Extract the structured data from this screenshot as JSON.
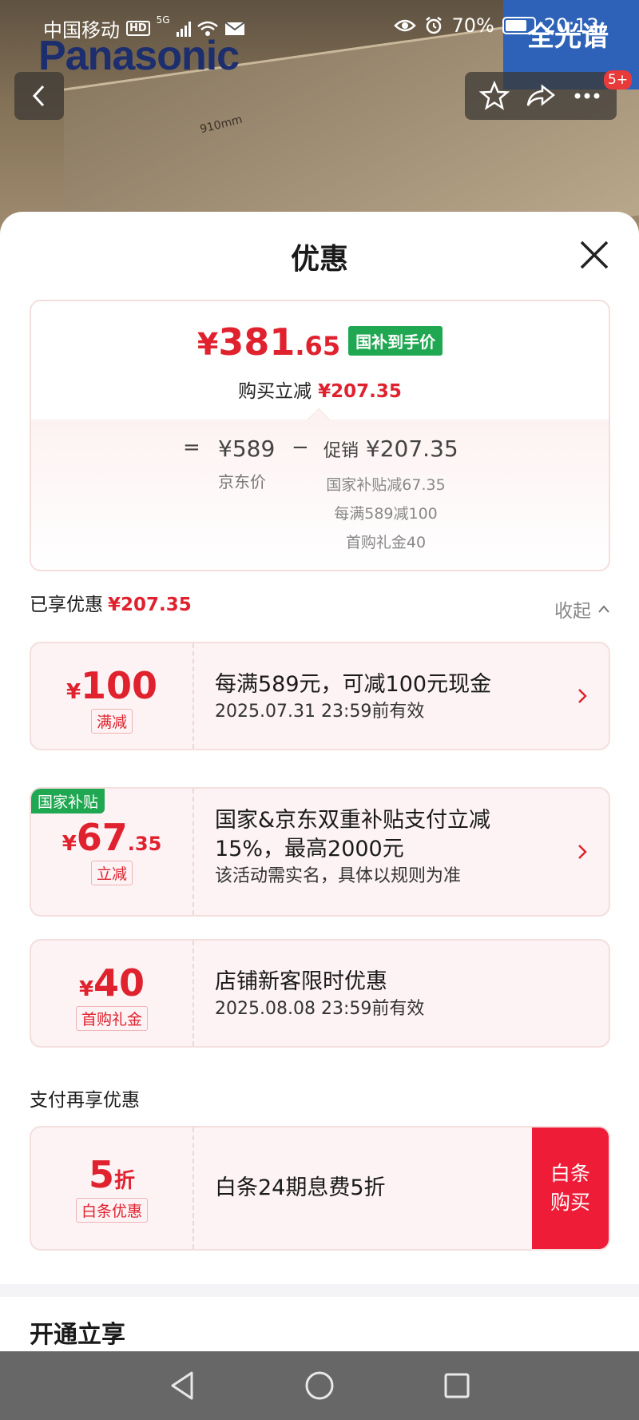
{
  "status_bar": {
    "carrier": "中国移动",
    "hd": "HD",
    "net": "5G",
    "battery": "70%",
    "time": "20:12"
  },
  "background": {
    "brand_logo": "Panasonic",
    "dimension": "910mm",
    "corner_text": "全光谱"
  },
  "top_bar": {
    "notification_badge": "5+"
  },
  "sheet": {
    "title": "优惠",
    "summary": {
      "final_price": {
        "currency": "¥",
        "integer": "381",
        "decimal": ".65"
      },
      "price_tag": "国补到手价",
      "reduction_label": "购买立减",
      "reduction_amount": "¥207.35",
      "equals": "=",
      "jd_price": "¥589",
      "jd_price_label": "京东价",
      "minus": "−",
      "promo_label": "促销",
      "promo_amount": "¥207.35",
      "promo_items": [
        "国家补贴减67.35",
        "每满589减100",
        "首购礼金40"
      ]
    },
    "enjoyed": {
      "label": "已享优惠",
      "amount": "¥207.35",
      "collapse_label": "收起"
    },
    "coupons": [
      {
        "currency": "¥",
        "amount": "100",
        "decimal": "",
        "tag": "满减",
        "title": "每满589元，可减100元现金",
        "line2": "",
        "sub": "2025.07.31 23:59前有效",
        "corner_tag": ""
      },
      {
        "currency": "¥",
        "amount": "67",
        "decimal": ".35",
        "tag": "立减",
        "title": "国家&京东双重补贴支付立减",
        "line2": "15%，最高2000元",
        "sub": "该活动需实名，具体以规则为准",
        "corner_tag": "国家补贴"
      },
      {
        "currency": "¥",
        "amount": "40",
        "decimal": "",
        "tag": "首购礼金",
        "title": "店铺新客限时优惠",
        "line2": "",
        "sub": "2025.08.08 23:59前有效",
        "corner_tag": ""
      }
    ],
    "pay_section": {
      "label": "支付再享优惠",
      "amount": "5",
      "unit": "折",
      "tag": "白条优惠",
      "title": "白条24期息费5折",
      "button_line1": "白条",
      "button_line2": "购买"
    },
    "open_section_title": "开通立享"
  },
  "colors": {
    "accent_red": "#e0212e",
    "subsidy_green": "#1fa851",
    "pay_button": "#ee1c36"
  }
}
